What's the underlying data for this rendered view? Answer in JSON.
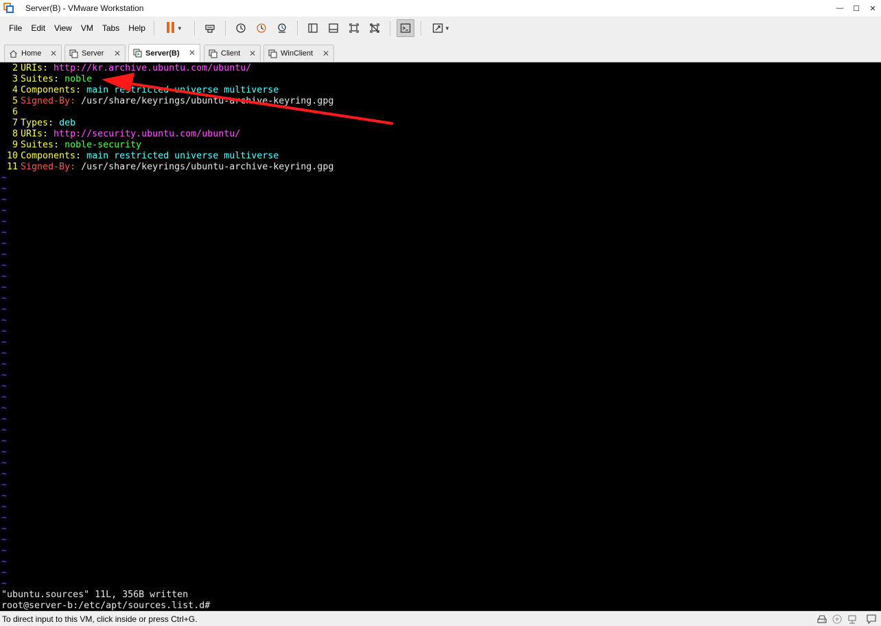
{
  "window": {
    "title": "Server(B) - VMware Workstation",
    "controls": {
      "minimize": "—",
      "maximize": "☐",
      "close": "✕"
    }
  },
  "menu": {
    "items": [
      "File",
      "Edit",
      "View",
      "VM",
      "Tabs",
      "Help"
    ]
  },
  "toolbar": {
    "icons": [
      "pause-icon",
      "send-keys-icon",
      "snapshot-take-icon",
      "snapshot-revert-icon",
      "snapshot-manager-icon",
      "sidebar-toggle-icon",
      "thumbnail-bar-icon",
      "full-screen-icon",
      "unity-icon",
      "console-view-icon",
      "stretch-view-icon"
    ],
    "accent": "#e0662a"
  },
  "tabs": [
    {
      "label": "Home",
      "icon": "home-icon",
      "active": false
    },
    {
      "label": "Server",
      "icon": "vm-icon",
      "active": false
    },
    {
      "label": "Server(B)",
      "icon": "vm-running-icon",
      "active": true
    },
    {
      "label": "Client",
      "icon": "vm-icon",
      "active": false
    },
    {
      "label": "WinClient",
      "icon": "vm-icon",
      "active": false
    }
  ],
  "terminal": {
    "lines": [
      {
        "num": "2",
        "key": "URIs:",
        "val": "http://kr.archive.ubuntu.com/ubuntu/",
        "key_color": "yellow",
        "val_color": "magenta"
      },
      {
        "num": "3",
        "key": "Suites:",
        "val": "noble",
        "key_color": "yellow",
        "val_color": "green"
      },
      {
        "num": "4",
        "key": "Components:",
        "val": "main restricted universe multiverse",
        "key_color": "yellow",
        "val_color": "cyan"
      },
      {
        "num": "5",
        "key": "Signed-By:",
        "val": "/usr/share/keyrings/ubuntu-archive-keyring.gpg",
        "key_color": "red",
        "val_color": "white"
      },
      {
        "num": "6",
        "key": "",
        "val": "",
        "key_color": "yellow",
        "val_color": "white"
      },
      {
        "num": "7",
        "key": "Types:",
        "val": "deb",
        "key_color": "yellow",
        "val_color": "cyan"
      },
      {
        "num": "8",
        "key": "URIs:",
        "val": "http://security.ubuntu.com/ubuntu/",
        "key_color": "yellow",
        "val_color": "magenta"
      },
      {
        "num": "9",
        "key": "Suites:",
        "val": "noble-security",
        "key_color": "yellow",
        "val_color": "green"
      },
      {
        "num": "10",
        "key": "Components:",
        "val": "main restricted universe multiverse",
        "key_color": "yellow",
        "val_color": "cyan"
      },
      {
        "num": "11",
        "key": "Signed-By:",
        "val": "/usr/share/keyrings/ubuntu-archive-keyring.gpg",
        "key_color": "red",
        "val_color": "white"
      }
    ],
    "tilde": "~",
    "status_message": "\"ubuntu.sources\" 11L, 356B written",
    "prompt": "root@server-b:/etc/apt/sources.list.d#",
    "annotation_color": "#ff1a1a"
  },
  "statusbar": {
    "message": "To direct input to this VM, click inside or press Ctrl+G.",
    "icons": [
      "hard-disk-icon",
      "cd-rom-icon",
      "network-icon",
      "message-icon"
    ]
  }
}
